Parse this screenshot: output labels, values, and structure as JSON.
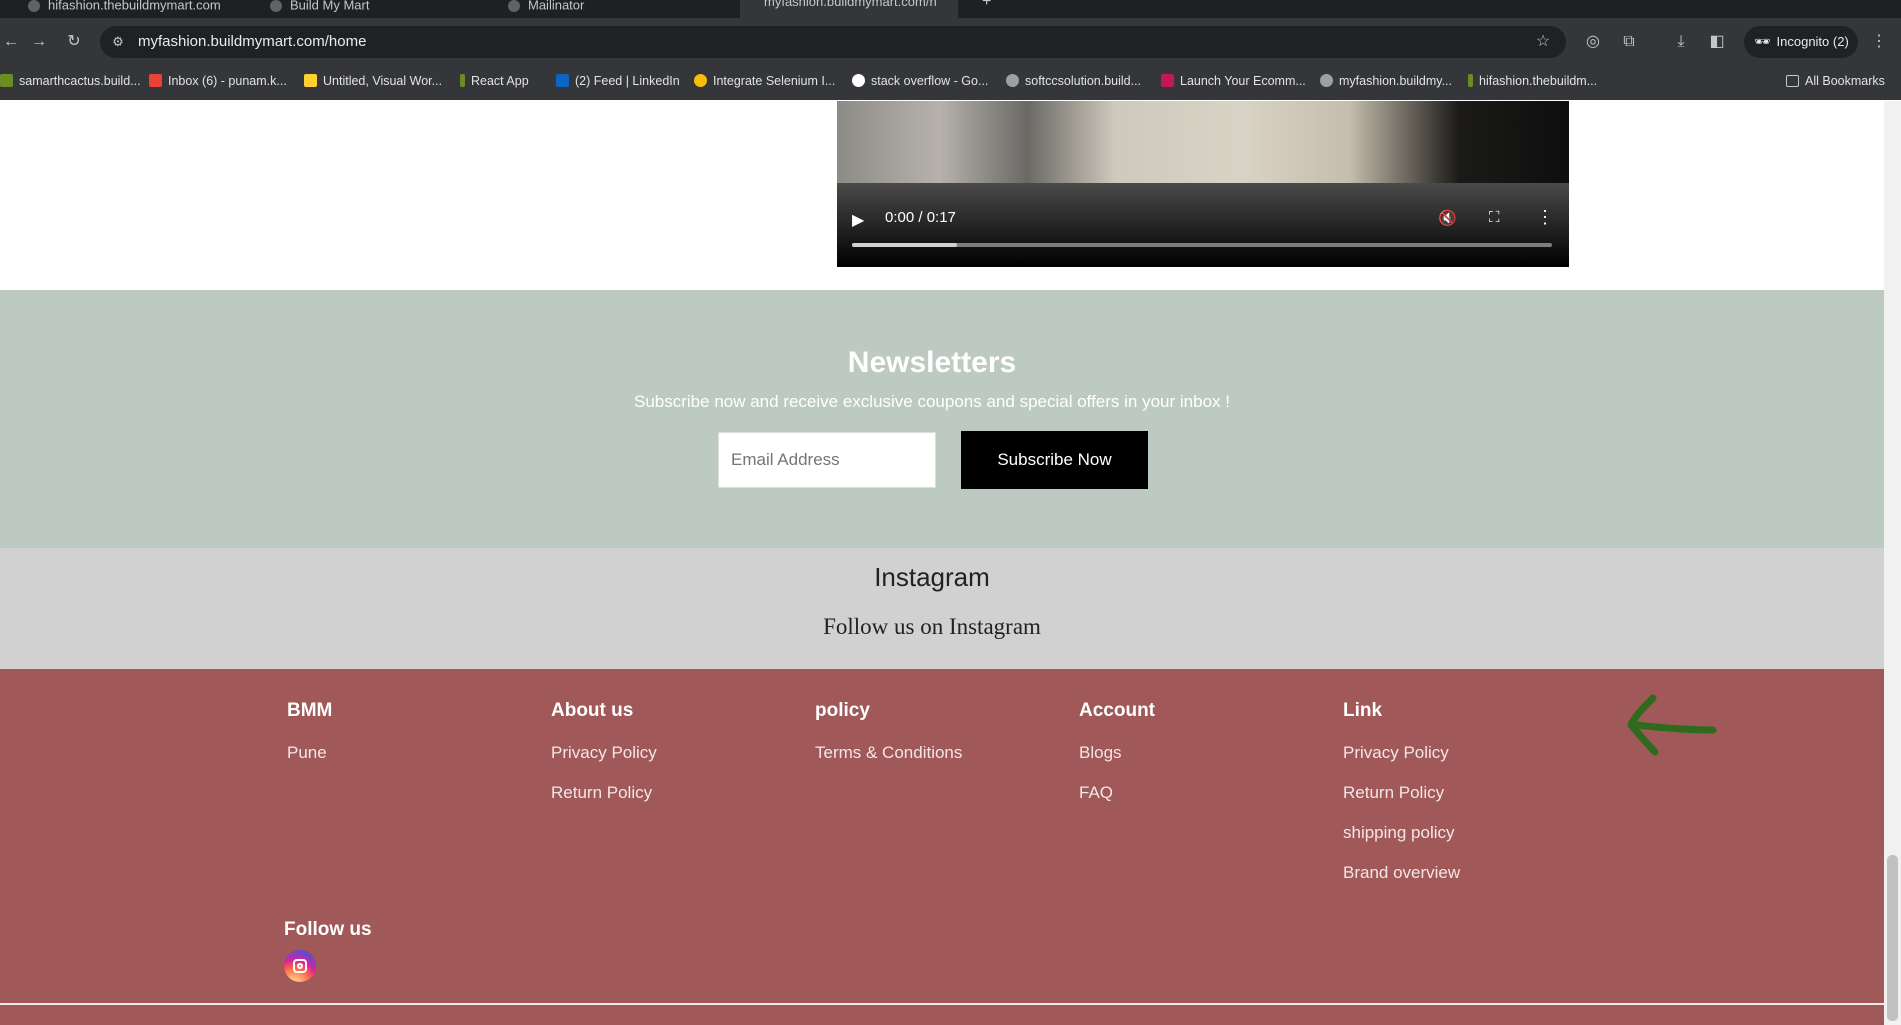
{
  "browser": {
    "tabs": [
      {
        "title": "hifashion.thebuildmymart.com"
      },
      {
        "title": "Build My Mart"
      },
      {
        "title": "Mailinator"
      },
      {
        "title": "myfashion.buildmymart.com/h"
      }
    ],
    "url": "myfashion.buildmymart.com/home",
    "incognito_label": "Incognito (2)",
    "bookmarks": [
      {
        "label": "samarthcactus.build...",
        "icon": "favicon-icon"
      },
      {
        "label": "Inbox (6) - punam.k...",
        "icon": "gmail-icon"
      },
      {
        "label": "Untitled, Visual Wor...",
        "icon": "miro-icon"
      },
      {
        "label": "React App",
        "icon": "favicon-icon"
      },
      {
        "label": "(2) Feed | LinkedIn",
        "icon": "linkedin-icon"
      },
      {
        "label": "Integrate Selenium I...",
        "icon": "chrome-icon"
      },
      {
        "label": "stack overflow - Go...",
        "icon": "google-icon"
      },
      {
        "label": "softccsolution.build...",
        "icon": "globe-icon"
      },
      {
        "label": "Launch Your Ecomm...",
        "icon": "favicon-icon"
      },
      {
        "label": "myfashion.buildmy...",
        "icon": "globe-icon"
      },
      {
        "label": "hifashion.thebuildm...",
        "icon": "favicon-icon"
      }
    ],
    "all_bookmarks": "All Bookmarks"
  },
  "video": {
    "time": "0:00 / 0:17",
    "progress": 0.15
  },
  "newsletter": {
    "title": "Newsletters",
    "subtitle": "Subscribe now and receive exclusive coupons and special offers in your inbox !",
    "email_placeholder": "Email Address",
    "button": "Subscribe Now",
    "bg_color": "#bccac2"
  },
  "instagram": {
    "title": "Instagram",
    "subtitle": "Follow us on Instagram"
  },
  "footer": {
    "bg_color": "#a05858",
    "columns": [
      {
        "heading": "BMM",
        "links": [
          "Pune"
        ]
      },
      {
        "heading": "About us",
        "links": [
          "Privacy Policy",
          "Return Policy"
        ]
      },
      {
        "heading": "policy",
        "links": [
          "Terms & Conditions"
        ]
      },
      {
        "heading": "Account",
        "links": [
          "Blogs",
          "FAQ"
        ]
      },
      {
        "heading": "Link",
        "links": [
          "Privacy Policy",
          "Return Policy",
          "shipping policy",
          "Brand overview"
        ]
      }
    ],
    "follow_label": "Follow us",
    "social_icon": "instagram-icon"
  }
}
